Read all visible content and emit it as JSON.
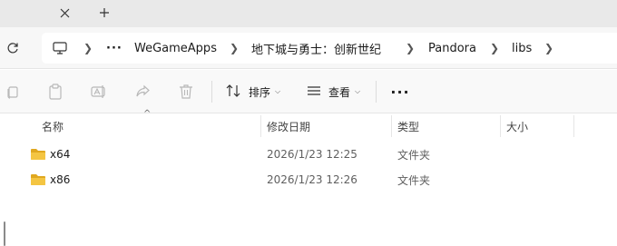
{
  "tabstrip": {
    "close_icon": "close-icon",
    "new_tab_icon": "plus-icon"
  },
  "address": {
    "refresh_icon": "refresh-icon",
    "computer_icon": "monitor-icon",
    "ellipsis": "···",
    "crumbs": [
      "WeGameApps",
      "地下城与勇士：创新世纪",
      "Pandora",
      "libs"
    ]
  },
  "toolbar": {
    "icons": [
      "copy-icon",
      "paste-icon",
      "rename-icon",
      "share-icon",
      "delete-icon"
    ],
    "sort_label": "排序",
    "view_label": "查看",
    "more_label": "···"
  },
  "columns": {
    "name": "名称",
    "modified": "修改日期",
    "type": "类型",
    "size": "大小"
  },
  "files": [
    {
      "name": "x64",
      "modified": "2026/1/23 12:25",
      "type": "文件夹",
      "size": ""
    },
    {
      "name": "x86",
      "modified": "2026/1/23 12:26",
      "type": "文件夹",
      "size": ""
    }
  ],
  "colors": {
    "folder": "#f4c542",
    "folder_dark": "#e0a820",
    "accent": "#1b1b1b"
  }
}
